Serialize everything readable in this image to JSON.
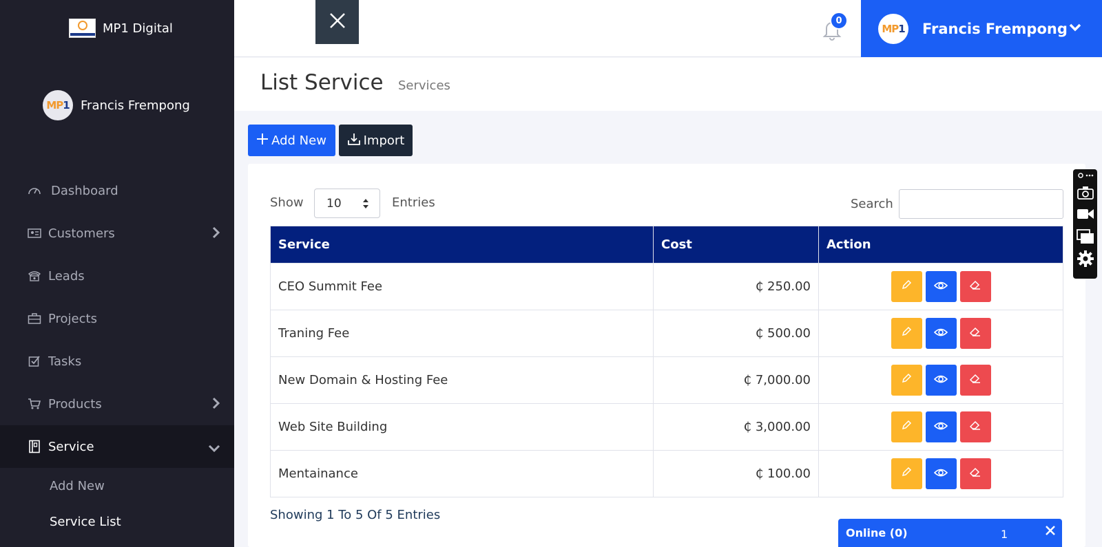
{
  "sidebar": {
    "brand": "MP1 Digital",
    "brand_logo_text": "MP1 DIGITAL",
    "user_name": "Francis Frempong",
    "avatar_initials": {
      "m": "MP",
      "p": "1"
    },
    "nav": [
      {
        "label": "Dashboard",
        "icon": "dashboard-gauge-icon"
      },
      {
        "label": "Customers",
        "icon": "id-card-icon"
      },
      {
        "label": "Leads",
        "icon": "telephone-icon"
      },
      {
        "label": "Projects",
        "icon": "briefcase-icon"
      },
      {
        "label": "Tasks",
        "icon": "checkbox-icon"
      },
      {
        "label": "Products",
        "icon": "cart-icon"
      },
      {
        "label": "Service",
        "icon": "book-icon"
      }
    ],
    "sub_items": [
      "Add New",
      "Service List"
    ]
  },
  "topbar": {
    "notification_count": "0",
    "user_name": "Francis Frempong"
  },
  "page": {
    "title": "List Service",
    "breadcrumb": "Services",
    "add_new_label": "Add New",
    "import_label": "Import"
  },
  "table_controls": {
    "show_label": "Show",
    "page_length": "10",
    "entries_label": "Entries",
    "search_label": "Search",
    "search_value": ""
  },
  "table": {
    "headers": [
      "Service",
      "Cost",
      "Action"
    ],
    "rows": [
      {
        "service": "CEO Summit Fee",
        "cost": "₵ 250.00"
      },
      {
        "service": "Traning Fee",
        "cost": "₵ 500.00"
      },
      {
        "service": "New Domain & Hosting Fee",
        "cost": "₵ 7,000.00"
      },
      {
        "service": "Web Site Building",
        "cost": "₵ 3,000.00"
      },
      {
        "service": "Mentainance",
        "cost": "₵ 100.00"
      }
    ]
  },
  "footer": {
    "info": "Showing 1 To 5 Of 5 Entries"
  },
  "online_chat": {
    "label": "Online (0)",
    "count": "1"
  },
  "colors": {
    "sidebar_bg": "#1f1f2b",
    "primary": "#1b5ff5",
    "table_header": "#03207e",
    "edit": "#fdb52a",
    "delete": "#ed4a4f"
  }
}
